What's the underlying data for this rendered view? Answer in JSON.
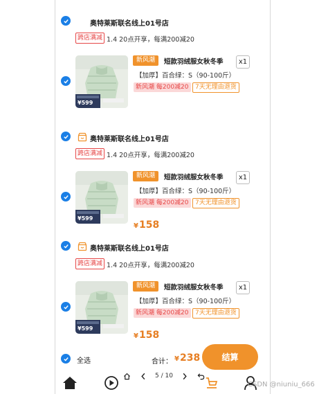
{
  "colors": {
    "accent": "#f0922b",
    "check": "#1a7fe6",
    "red": "#e64545",
    "price": "#e67e22"
  },
  "shops": [
    {
      "name": "奥特莱斯联名线上01号店",
      "promo_tag": "跨店满减",
      "promo_text": "1.4 20点开享，每满200减20",
      "item": {
        "tag": "新风潮",
        "title": "短款羽绒服女秋冬季",
        "qty": "x1",
        "spec": "【加厚】百合绿：S（90-100斤）",
        "discount": "新风潮 每200减20",
        "return_tag": "7天无理由退货",
        "price_symbol": "",
        "price": "",
        "thumb_price": "599"
      }
    },
    {
      "name": "奥特莱斯联名线上01号店",
      "promo_tag": "跨店满减",
      "promo_text": "1.4 20点开享，每满200减20",
      "item": {
        "tag": "新风潮",
        "title": "短款羽绒服女秋冬季",
        "qty": "x1",
        "spec": "【加厚】百合绿：S（90-100斤）",
        "discount": "新风潮 每200减20",
        "return_tag": "7天无理由退货",
        "price_symbol": "¥",
        "price": "158",
        "thumb_price": "599"
      }
    },
    {
      "name": "奥特莱斯联名线上01号店",
      "promo_tag": "跨店满减",
      "promo_text": "1.4 20点开享，每满200减20",
      "item": {
        "tag": "新风潮",
        "title": "短款羽绒服女秋冬季",
        "qty": "x1",
        "spec": "【加厚】百合绿：S（90-100斤）",
        "discount": "新风潮 每200减20",
        "return_tag": "7天无理由退货",
        "price_symbol": "¥",
        "price": "158",
        "thumb_price": "599"
      }
    }
  ],
  "footer": {
    "select_all": "全选",
    "total_label": "合计：",
    "total_symbol": "¥",
    "total_value": "238",
    "checkout": "结算"
  },
  "pager": {
    "current_page": "5 / 10"
  },
  "bottom_nav": [
    "home-icon",
    "play-icon",
    "cart-icon",
    "profile-icon"
  ],
  "watermark": "CSDN @niuniu_666"
}
